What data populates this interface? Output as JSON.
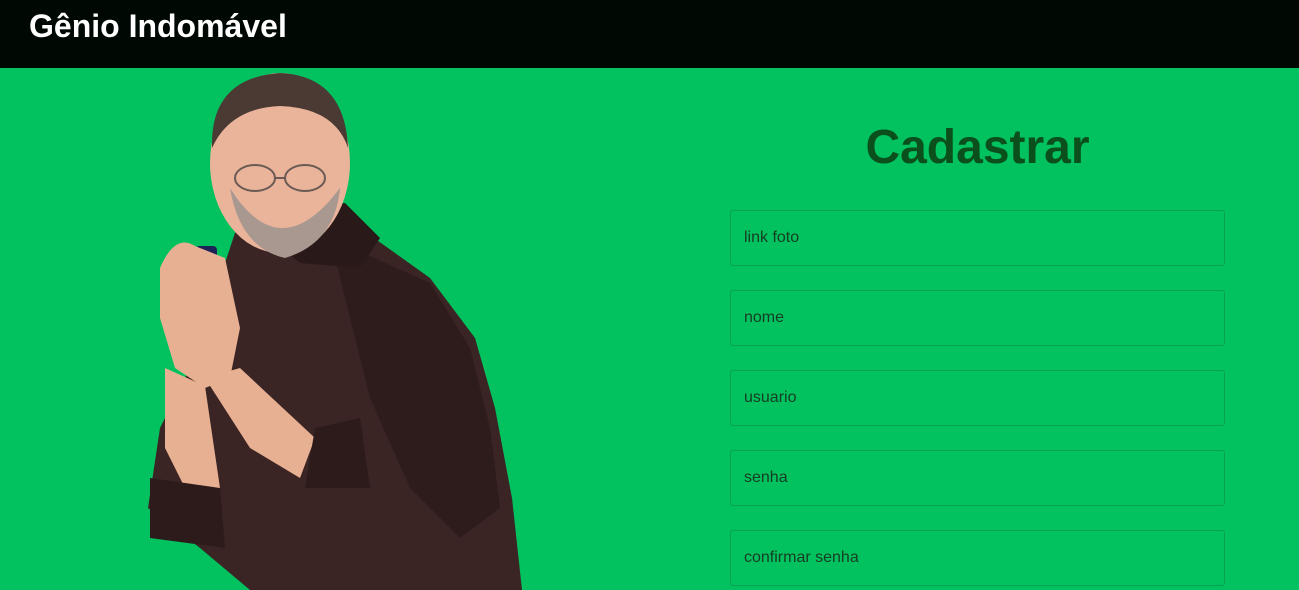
{
  "header": {
    "brand": "Gênio Indomável"
  },
  "page": {
    "title": "Cadastrar",
    "fields": [
      {
        "placeholder": "link foto"
      },
      {
        "placeholder": "nome"
      },
      {
        "placeholder": "usuario"
      },
      {
        "placeholder": "senha"
      },
      {
        "placeholder": "confirmar senha"
      }
    ]
  },
  "colors": {
    "background": "#02c15f",
    "navbar": "#000803",
    "title": "#0a4f1c",
    "field_border": "#0aa24f"
  }
}
